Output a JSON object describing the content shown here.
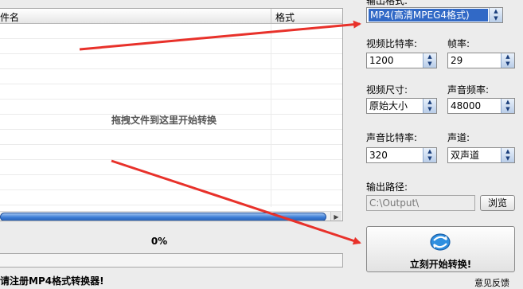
{
  "file_list": {
    "col_name": "件名",
    "col_format": "格式",
    "drop_hint": "拖拽文件到这里开始转换"
  },
  "progress": {
    "percent_text": "0%",
    "value": 0
  },
  "settings": {
    "output_format_label": "输出格式:",
    "output_format_value": "MP4(高清MPEG4格式)",
    "video_bitrate_label": "视频比特率:",
    "video_bitrate_value": "1200",
    "framerate_label": "帧率:",
    "framerate_value": "29",
    "video_size_label": "视频尺寸:",
    "video_size_value": "原始大小",
    "sample_rate_label": "声音频率:",
    "sample_rate_value": "48000",
    "audio_bitrate_label": "声音比特率:",
    "audio_bitrate_value": "320",
    "channel_label": "声道:",
    "channel_value": "双声道",
    "output_path_label": "输出路径:",
    "output_path_value": "C:\\Output\\",
    "browse_label": "浏览",
    "convert_label": "立刻开始转换!"
  },
  "footer": {
    "left_text": "请注册MP4格式转换器!",
    "right_text": "意见反馈"
  },
  "colors": {
    "arrow": "#e8312a",
    "selection": "#3169c6"
  }
}
